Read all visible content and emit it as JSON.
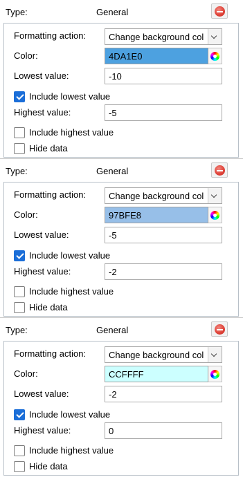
{
  "rules": [
    {
      "type_label": "Type:",
      "type_value": "General",
      "formatting_action_label": "Formatting action:",
      "formatting_action_value": "Change background col",
      "color_label": "Color:",
      "color_value": "4DA1E0",
      "color_hex": "#4DA1E0",
      "lowest_label": "Lowest value:",
      "lowest_value": "-10",
      "include_lowest_label": "Include lowest value",
      "include_lowest_checked": true,
      "highest_label": "Highest value:",
      "highest_value": "-5",
      "include_highest_label": "Include highest value",
      "include_highest_checked": false,
      "hide_data_label": "Hide data",
      "hide_data_checked": false
    },
    {
      "type_label": "Type:",
      "type_value": "General",
      "formatting_action_label": "Formatting action:",
      "formatting_action_value": "Change background col",
      "color_label": "Color:",
      "color_value": "97BFE8",
      "color_hex": "#97BFE8",
      "lowest_label": "Lowest value:",
      "lowest_value": "-5",
      "include_lowest_label": "Include lowest value",
      "include_lowest_checked": true,
      "highest_label": "Highest value:",
      "highest_value": "-2",
      "include_highest_label": "Include highest value",
      "include_highest_checked": false,
      "hide_data_label": "Hide data",
      "hide_data_checked": false
    },
    {
      "type_label": "Type:",
      "type_value": "General",
      "formatting_action_label": "Formatting action:",
      "formatting_action_value": "Change background col",
      "color_label": "Color:",
      "color_value": "CCFFFF",
      "color_hex": "#CCFFFF",
      "lowest_label": "Lowest value:",
      "lowest_value": "-2",
      "include_lowest_label": "Include lowest value",
      "include_lowest_checked": true,
      "highest_label": "Highest value:",
      "highest_value": "0",
      "include_highest_label": "Include highest value",
      "include_highest_checked": false,
      "hide_data_label": "Hide data",
      "hide_data_checked": false
    }
  ],
  "icons": {
    "remove": "remove-icon",
    "dropdown": "chevron-down-icon",
    "color_picker": "color-wheel-icon",
    "checkbox": "checkmark-icon"
  }
}
